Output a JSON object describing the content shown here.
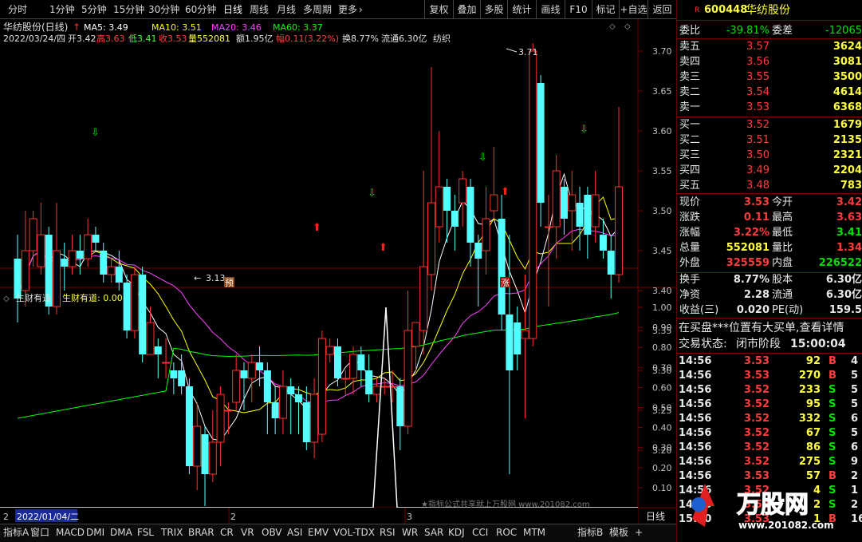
{
  "toolbar": {
    "periods": [
      "分时",
      "1分钟",
      "5分钟",
      "15分钟",
      "30分钟",
      "60分钟",
      "日线",
      "周线",
      "月线",
      "多周期",
      "更多"
    ],
    "buttons": [
      "复权",
      "叠加",
      "多股",
      "统计",
      "画线",
      "F10",
      "标记",
      "+自选",
      "返回"
    ]
  },
  "info": {
    "title": "华纺股份(日线)",
    "ma5": "MA5: 3.49",
    "ma10": "MA10: 3.51",
    "ma20": "MA20: 3.46",
    "ma60": "MA60: 3.37",
    "date": "2022/03/24/四",
    "open": "开3.42",
    "high": "高3.63",
    "low": "低3.41",
    "close": "收3.53",
    "vol": "量552081",
    "amt": "额1.95亿",
    "chg": "幅0.11(3.22%)",
    "turn": "换8.77%",
    "float": "流通6.30亿",
    "sector": "纺织"
  },
  "labels": {
    "hi": "3.71",
    "lo": "3.13",
    "pre": "预",
    "zhang": "涨"
  },
  "ind": {
    "name": "生财有道",
    "series": "生财有道: 0.00",
    "xdate": "2022/01/04/二",
    "x2": "2",
    "x3": "3",
    "x0": "2",
    "period": "日线"
  },
  "colors": {
    "up": "#ff3030",
    "down": "#54ffff",
    "ma5": "#ffffff",
    "ma10": "#ffff00",
    "ma20": "#ff40ff",
    "ma60": "#00ff00",
    "border": "#7a0000"
  },
  "chart_data": {
    "type": "candlestick",
    "yticks": [
      "3.70",
      "3.65",
      "3.60",
      "3.55",
      "3.50",
      "3.45",
      "3.40",
      "3.35",
      "3.30",
      "3.25",
      "3.20"
    ],
    "ind_yticks": [
      "1.00",
      "0.90",
      "0.80",
      "0.70",
      "0.60",
      "0.50",
      "0.40",
      "0.30",
      "0.20",
      "0.10"
    ],
    "ylim": [
      3.13,
      3.71
    ],
    "candles": [
      [
        3.44,
        3.39,
        3.47,
        3.36
      ],
      [
        3.4,
        3.45,
        3.5,
        3.38
      ],
      [
        3.45,
        3.49,
        3.5,
        3.43
      ],
      [
        3.43,
        3.47,
        3.51,
        3.42
      ],
      [
        3.47,
        3.38,
        3.48,
        3.37
      ],
      [
        3.38,
        3.45,
        3.51,
        3.37
      ],
      [
        3.44,
        3.43,
        3.46,
        3.4
      ],
      [
        3.43,
        3.45,
        3.47,
        3.42
      ],
      [
        3.45,
        3.44,
        3.47,
        3.42
      ],
      [
        3.44,
        3.47,
        3.49,
        3.43
      ],
      [
        3.47,
        3.46,
        3.48,
        3.45
      ],
      [
        3.45,
        3.42,
        3.46,
        3.41
      ],
      [
        3.42,
        3.43,
        3.44,
        3.41
      ],
      [
        3.43,
        3.41,
        3.45,
        3.4
      ],
      [
        3.41,
        3.35,
        3.42,
        3.34
      ],
      [
        3.35,
        3.42,
        3.43,
        3.34
      ],
      [
        3.42,
        3.32,
        3.43,
        3.31
      ],
      [
        3.32,
        3.36,
        3.38,
        3.32
      ],
      [
        3.33,
        3.32,
        3.34,
        3.29
      ],
      [
        3.31,
        3.31,
        3.34,
        3.29
      ],
      [
        3.3,
        3.29,
        3.31,
        3.27
      ],
      [
        3.3,
        3.28,
        3.32,
        3.27
      ],
      [
        3.28,
        3.18,
        3.29,
        3.17
      ],
      [
        3.18,
        3.23,
        3.26,
        3.15
      ],
      [
        3.22,
        3.17,
        3.23,
        3.13
      ],
      [
        3.17,
        3.21,
        3.25,
        3.16
      ],
      [
        3.21,
        3.27,
        3.28,
        3.18
      ],
      [
        3.25,
        3.25,
        3.26,
        3.22
      ],
      [
        3.26,
        3.3,
        3.32,
        3.25
      ],
      [
        3.3,
        3.29,
        3.31,
        3.25
      ],
      [
        3.29,
        3.31,
        3.32,
        3.26
      ],
      [
        3.31,
        3.3,
        3.33,
        3.28
      ],
      [
        3.3,
        3.26,
        3.31,
        3.22
      ],
      [
        3.26,
        3.24,
        3.28,
        3.22
      ],
      [
        3.24,
        3.28,
        3.3,
        3.22
      ],
      [
        3.28,
        3.27,
        3.29,
        3.22
      ],
      [
        3.27,
        3.26,
        3.28,
        3.22
      ],
      [
        3.26,
        3.21,
        3.28,
        3.2
      ],
      [
        3.21,
        3.27,
        3.29,
        3.19
      ],
      [
        3.22,
        3.34,
        3.35,
        3.21
      ],
      [
        3.32,
        3.33,
        3.34,
        3.31
      ],
      [
        3.33,
        3.29,
        3.34,
        3.28
      ],
      [
        3.29,
        3.29,
        3.3,
        3.27
      ],
      [
        3.29,
        3.32,
        3.33,
        3.27
      ],
      [
        3.32,
        3.3,
        3.33,
        3.28
      ],
      [
        3.3,
        3.27,
        3.32,
        3.26
      ],
      [
        3.27,
        3.28,
        3.29,
        3.26
      ],
      [
        3.28,
        3.28,
        3.29,
        3.27
      ],
      [
        3.28,
        3.28,
        3.3,
        3.26
      ],
      [
        3.28,
        3.23,
        3.29,
        3.2
      ],
      [
        3.23,
        3.35,
        3.4,
        3.22
      ],
      [
        3.33,
        3.36,
        3.36,
        3.3
      ],
      [
        3.35,
        3.43,
        3.55,
        3.32
      ],
      [
        3.42,
        3.51,
        3.68,
        3.4
      ],
      [
        3.48,
        3.53,
        3.6,
        3.46
      ],
      [
        3.53,
        3.5,
        3.54,
        3.46
      ],
      [
        3.5,
        3.48,
        3.52,
        3.45
      ],
      [
        3.51,
        3.54,
        3.55,
        3.48
      ],
      [
        3.53,
        3.46,
        3.54,
        3.43
      ],
      [
        3.46,
        3.44,
        3.47,
        3.38
      ],
      [
        3.45,
        3.49,
        3.53,
        3.42
      ],
      [
        3.5,
        3.52,
        3.58,
        3.49
      ],
      [
        3.49,
        3.37,
        3.52,
        3.35
      ],
      [
        3.37,
        3.3,
        3.47,
        3.17
      ],
      [
        3.36,
        3.32,
        3.38,
        3.3
      ],
      [
        3.34,
        3.35,
        3.42,
        3.24
      ],
      [
        3.34,
        3.7,
        3.71,
        3.33
      ],
      [
        3.66,
        3.51,
        3.67,
        3.48
      ],
      [
        3.48,
        3.48,
        3.52,
        3.38
      ],
      [
        3.48,
        3.55,
        3.57,
        3.44
      ],
      [
        3.53,
        3.49,
        3.54,
        3.47
      ],
      [
        3.5,
        3.52,
        3.55,
        3.45
      ],
      [
        3.51,
        3.48,
        3.53,
        3.45
      ],
      [
        3.52,
        3.47,
        3.53,
        3.44
      ],
      [
        3.48,
        3.52,
        3.55,
        3.46
      ],
      [
        3.47,
        3.45,
        3.49,
        3.44
      ],
      [
        3.45,
        3.42,
        3.47,
        3.39
      ],
      [
        3.42,
        3.53,
        3.63,
        3.41
      ]
    ]
  },
  "bottom_tabs": [
    "指标A",
    "窗口",
    "MACD",
    "DMI",
    "DMA",
    "FSL",
    "TRIX",
    "BRAR",
    "CR",
    "VR",
    "OBV",
    "ASI",
    "EMV",
    "VOL-TDX",
    "RSI",
    "WR",
    "SAR",
    "KDJ",
    "CCI",
    "ROC",
    "MTM",
    "指标B",
    "模板",
    "+"
  ],
  "quote": {
    "code": "600448",
    "name": "华纺股份",
    "rmark": "R",
    "wb_label": "委比",
    "wb_val": "-39.81%",
    "wc_label": "委差",
    "wc_val": "-12065",
    "sells": [
      [
        "卖五",
        "3.57",
        "3624"
      ],
      [
        "卖四",
        "3.56",
        "3081"
      ],
      [
        "卖三",
        "3.55",
        "3500"
      ],
      [
        "卖二",
        "3.54",
        "4614"
      ],
      [
        "卖一",
        "3.53",
        "6368"
      ]
    ],
    "buys": [
      [
        "买一",
        "3.52",
        "1679"
      ],
      [
        "买二",
        "3.51",
        "2135"
      ],
      [
        "买三",
        "3.50",
        "2321"
      ],
      [
        "买四",
        "3.49",
        "2204"
      ],
      [
        "买五",
        "3.48",
        "783"
      ]
    ],
    "stats": [
      [
        "现价",
        "3.53",
        "今开",
        "3.42"
      ],
      [
        "涨跌",
        "0.11",
        "最高",
        "3.63"
      ],
      [
        "涨幅",
        "3.22%",
        "最低",
        "3.41"
      ],
      [
        "总量",
        "552081",
        "量比",
        "1.34"
      ],
      [
        "外盘",
        "325559",
        "内盘",
        "226522"
      ]
    ],
    "stats2": [
      [
        "换手",
        "8.77%",
        "股本",
        "6.30亿"
      ],
      [
        "净资",
        "2.28",
        "流通",
        "6.30亿"
      ],
      [
        "收益(三)",
        "0.020",
        "PE(动)",
        "159.5"
      ]
    ],
    "notice": "在买盘***位置有大买单,查看详情",
    "state_label": "交易状态:",
    "state": "闭市阶段",
    "state_time": "15:00:04",
    "ticks": [
      [
        "14:56",
        "3.53",
        "92",
        "B",
        "4"
      ],
      [
        "14:56",
        "3.53",
        "270",
        "B",
        "5"
      ],
      [
        "14:56",
        "3.52",
        "233",
        "S",
        "5"
      ],
      [
        "14:56",
        "3.52",
        "95",
        "S",
        "5"
      ],
      [
        "14:56",
        "3.52",
        "332",
        "S",
        "6"
      ],
      [
        "14:56",
        "3.52",
        "67",
        "S",
        "5"
      ],
      [
        "14:56",
        "3.52",
        "86",
        "S",
        "6"
      ],
      [
        "14:56",
        "3.52",
        "275",
        "S",
        "9"
      ],
      [
        "14:56",
        "3.53",
        "57",
        "B",
        "2"
      ],
      [
        "14:56",
        "3.52",
        "4",
        "S",
        "1"
      ],
      [
        "14:56",
        "3.52",
        "2",
        "S",
        "2"
      ],
      [
        "15:00",
        "3.53",
        "1",
        "B",
        "160"
      ]
    ]
  },
  "watermark": {
    "brand": "万股网",
    "url": "www.201082.com",
    "notice": "★指标公式共享就上万股网 www.201082.com"
  }
}
